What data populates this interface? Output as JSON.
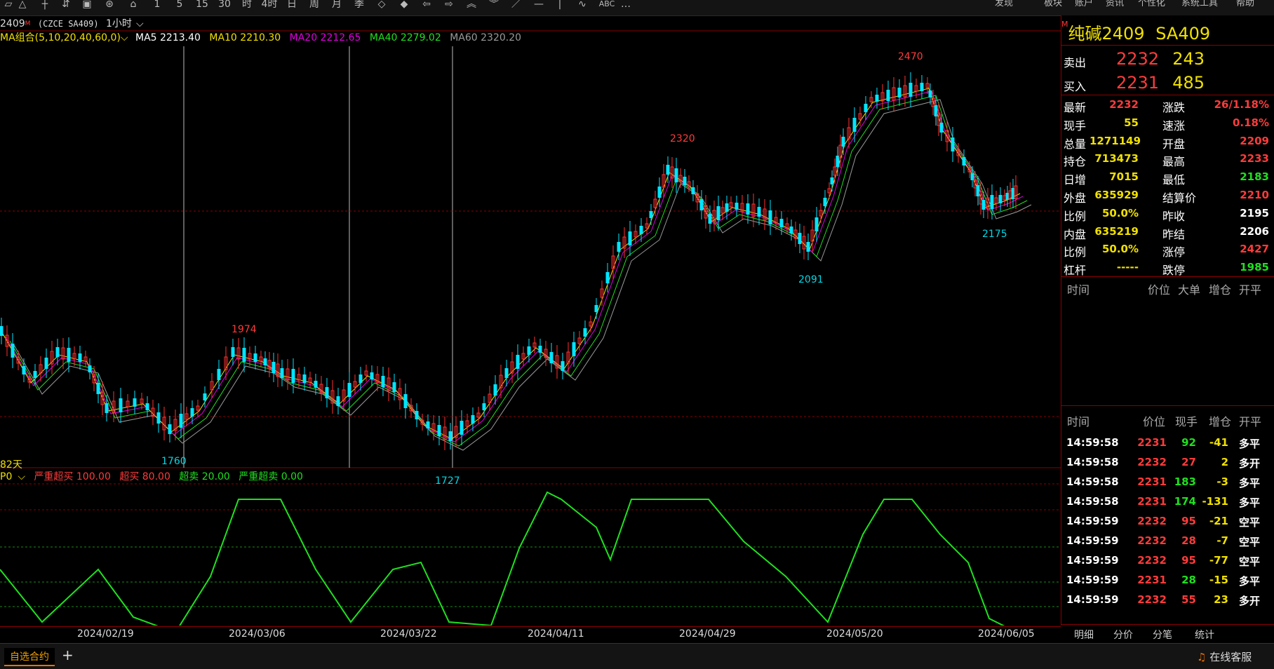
{
  "toolbar": {
    "menus": [
      "发现",
      "板块",
      "账户",
      "资讯",
      "个性化",
      "系统工具",
      "帮助"
    ]
  },
  "chart": {
    "symbol_code": "2409",
    "symbol_suffix": "M",
    "symbol_full": "(CZCE SA409)",
    "period": "1小时",
    "ma_group": "MA组合(5,10,20,40,60,0)",
    "ma": [
      {
        "label": "MA5 2213.40",
        "color": "#ffffff"
      },
      {
        "label": "MA10 2210.30",
        "color": "#f0e000"
      },
      {
        "label": "MA20 2212.65",
        "color": "#e000e0"
      },
      {
        "label": "MA40 2279.02",
        "color": "#1fe01f"
      },
      {
        "label": "MA60 2320.20",
        "color": "#9a9a9a"
      }
    ],
    "markers": {
      "h1": "1974",
      "l1": "1760",
      "l2": "1727",
      "h2": "2320",
      "l3": "2091",
      "h3": "2470",
      "l4": "2175"
    },
    "days_label": "82天",
    "dates": [
      "2024/02/19",
      "2024/03/06",
      "2024/03/22",
      "2024/04/11",
      "2024/04/29",
      "2024/05/20",
      "2024/06/05"
    ]
  },
  "oscillator": {
    "name": "P0",
    "items": [
      {
        "label": "严重超买 100.00",
        "color": "#ff3b3b"
      },
      {
        "label": "超买 80.00",
        "color": "#ff3b3b"
      },
      {
        "label": "超卖 20.00",
        "color": "#1fe01f"
      },
      {
        "label": "严重超卖 0.00",
        "color": "#1fe01f"
      }
    ]
  },
  "bottom_bar": {
    "watchlist_tab": "自选合约",
    "add": "+",
    "service": "在线客服"
  },
  "quote": {
    "flag": "M",
    "title": "纯碱2409",
    "code": "SA409",
    "sell_label": "卖出",
    "sell_price": "2232",
    "sell_vol": "243",
    "buy_label": "买入",
    "buy_price": "2231",
    "buy_vol": "485",
    "stats": [
      {
        "l": "最新",
        "v": "2232",
        "vc": "red",
        "l2": "涨跌",
        "v2": "26/1.18%",
        "vc2": "red"
      },
      {
        "l": "现手",
        "v": "55",
        "vc": "yellow",
        "l2": "速涨",
        "v2": "0.18%",
        "vc2": "red"
      },
      {
        "l": "总量",
        "v": "1271149",
        "vc": "yellow",
        "l2": "开盘",
        "v2": "2209",
        "vc2": "red"
      },
      {
        "l": "持仓",
        "v": "713473",
        "vc": "yellow",
        "l2": "最高",
        "v2": "2233",
        "vc2": "red"
      },
      {
        "l": "日增",
        "v": "7015",
        "vc": "yellow",
        "l2": "最低",
        "v2": "2183",
        "vc2": "green"
      },
      {
        "l": "外盘",
        "v": "635929",
        "vc": "yellow",
        "l2": "结算价",
        "v2": "2210",
        "vc2": "red"
      },
      {
        "l": "比例",
        "v": "50.0%",
        "vc": "yellow",
        "l2": "昨收",
        "v2": "2195",
        "vc2": "white"
      },
      {
        "l": "内盘",
        "v": "635219",
        "vc": "yellow",
        "l2": "昨结",
        "v2": "2206",
        "vc2": "white"
      },
      {
        "l": "比例",
        "v": "50.0%",
        "vc": "yellow",
        "l2": "涨停",
        "v2": "2427",
        "vc2": "red"
      },
      {
        "l": "杠杆",
        "v": "-----",
        "vc": "yellow",
        "l2": "跌停",
        "v2": "1985",
        "vc2": "green"
      }
    ],
    "big_header": [
      "时间",
      "价位",
      "大单",
      "增仓",
      "开平"
    ],
    "tick_header": [
      "时间",
      "价位",
      "现手",
      "增仓",
      "开平"
    ],
    "ticks": [
      {
        "t": "14:59:58",
        "p": "2231",
        "pc": "red",
        "q": "92",
        "qc": "green",
        "z": "-41",
        "zc": "yellow",
        "k": "多平"
      },
      {
        "t": "14:59:58",
        "p": "2232",
        "pc": "red",
        "q": "27",
        "qc": "red",
        "z": "2",
        "zc": "yellow",
        "k": "多开"
      },
      {
        "t": "14:59:58",
        "p": "2231",
        "pc": "red",
        "q": "183",
        "qc": "green",
        "z": "-3",
        "zc": "yellow",
        "k": "多平"
      },
      {
        "t": "14:59:58",
        "p": "2231",
        "pc": "red",
        "q": "174",
        "qc": "green",
        "z": "-131",
        "zc": "yellow",
        "k": "多平"
      },
      {
        "t": "14:59:59",
        "p": "2232",
        "pc": "red",
        "q": "95",
        "qc": "red",
        "z": "-21",
        "zc": "yellow",
        "k": "空平"
      },
      {
        "t": "14:59:59",
        "p": "2232",
        "pc": "red",
        "q": "28",
        "qc": "red",
        "z": "-7",
        "zc": "yellow",
        "k": "空平"
      },
      {
        "t": "14:59:59",
        "p": "2232",
        "pc": "red",
        "q": "95",
        "qc": "red",
        "z": "-77",
        "zc": "yellow",
        "k": "空平"
      },
      {
        "t": "14:59:59",
        "p": "2231",
        "pc": "red",
        "q": "28",
        "qc": "green",
        "z": "-15",
        "zc": "yellow",
        "k": "多平"
      },
      {
        "t": "14:59:59",
        "p": "2232",
        "pc": "red",
        "q": "55",
        "qc": "red",
        "z": "23",
        "zc": "yellow",
        "k": "多开"
      }
    ],
    "tabs": [
      "明细",
      "分价",
      "分笔",
      "统计"
    ]
  }
}
